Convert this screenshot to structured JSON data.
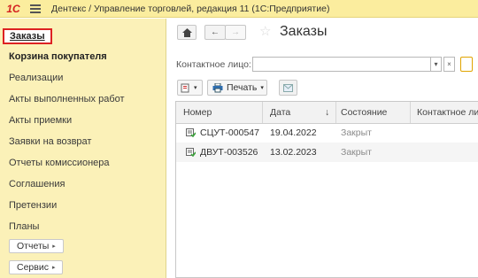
{
  "titlebar": {
    "logo": "1С",
    "title": "Дентекс / Управление торговлей, редакция 11  (1С:Предприятие)"
  },
  "sidebar": {
    "items": [
      {
        "label": "Заказы"
      },
      {
        "label": "Корзина покупателя"
      },
      {
        "label": "Реализации"
      },
      {
        "label": "Акты выполненных работ"
      },
      {
        "label": "Акты приемки"
      },
      {
        "label": "Заявки на возврат"
      },
      {
        "label": "Отчеты комиссионера"
      },
      {
        "label": "Соглашения"
      },
      {
        "label": "Претензии"
      },
      {
        "label": "Планы"
      }
    ],
    "buttons": [
      {
        "label": "Отчеты"
      },
      {
        "label": "Сервис"
      }
    ]
  },
  "main": {
    "title": "Заказы",
    "filter": {
      "label": "Контактное лицо:",
      "value": ""
    },
    "toolbar": {
      "print_label": "Печать"
    },
    "table": {
      "columns": [
        "Номер",
        "Дата",
        "Состояние",
        "Контактное ли"
      ],
      "sort_indicator": "↓",
      "rows": [
        {
          "number": "СЦУТ-000547",
          "date": "19.04.2022",
          "status": "Закрыт",
          "contact": ""
        },
        {
          "number": "ДВУТ-003526",
          "date": "13.02.2023",
          "status": "Закрыт",
          "contact": ""
        }
      ]
    }
  },
  "colors": {
    "titlebar_bg": "#fbed9e",
    "sidebar_bg": "#fbf1b8",
    "active_border": "#dd2222",
    "accent_green": "#3aa23a"
  }
}
